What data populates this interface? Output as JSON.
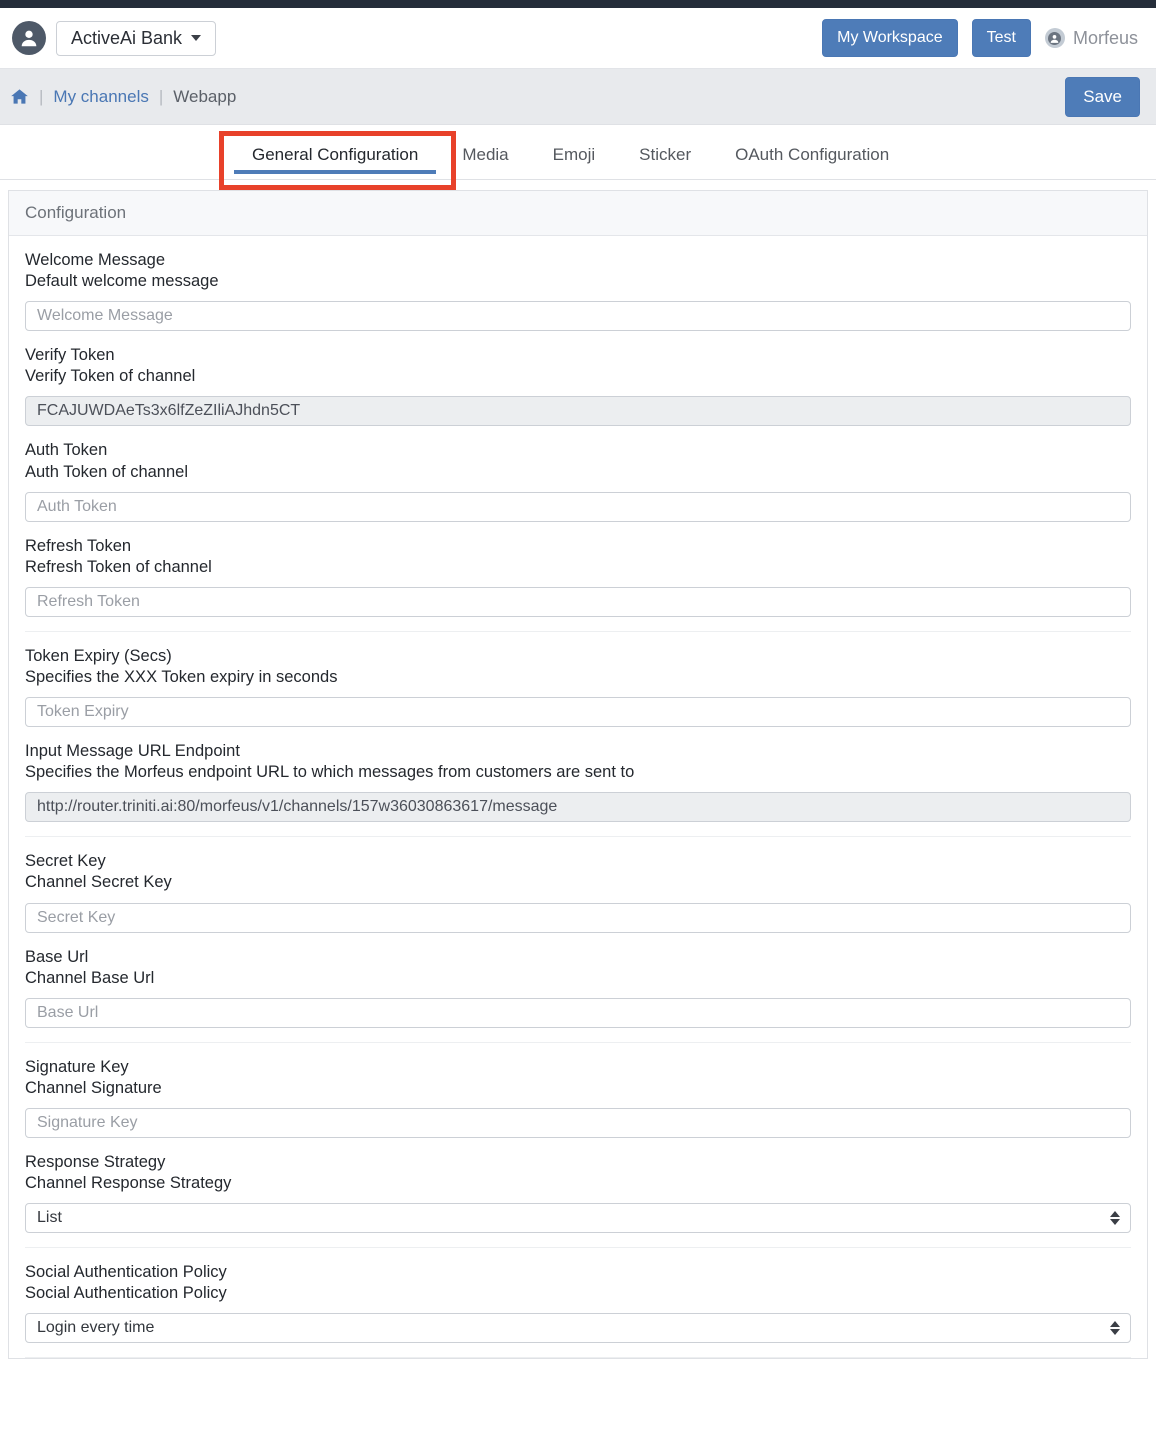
{
  "topbar": {
    "avatar_icon": "user-avatar-icon",
    "org_name": "ActiveAi Bank",
    "workspace_button": "My Workspace",
    "test_button": "Test",
    "user_name": "Morfeus",
    "user_icon": "user-circle-icon"
  },
  "breadcrumb": {
    "home_icon": "home-icon",
    "separator": "|",
    "channels_link": "My channels",
    "current": "Webapp",
    "save_button": "Save"
  },
  "tabs": [
    {
      "label": "General Configuration",
      "active": true
    },
    {
      "label": "Media",
      "active": false
    },
    {
      "label": "Emoji",
      "active": false
    },
    {
      "label": "Sticker",
      "active": false
    },
    {
      "label": "OAuth Configuration",
      "active": false
    }
  ],
  "panel": {
    "title": "Configuration"
  },
  "fields": [
    {
      "label": "Welcome Message",
      "desc": "Default welcome message",
      "type": "text",
      "value": "",
      "placeholder": "Welcome Message",
      "readonly": false
    },
    {
      "label": "Verify Token",
      "desc": "Verify Token of channel",
      "type": "text",
      "value": "FCAJUWDAeTs3x6lfZeZIliAJhdn5CT",
      "placeholder": "",
      "readonly": true
    },
    {
      "label": "Auth Token",
      "desc": "Auth Token of channel",
      "type": "text",
      "value": "",
      "placeholder": "Auth Token",
      "readonly": false
    },
    {
      "label": "Refresh Token",
      "desc": "Refresh Token of channel",
      "type": "text",
      "value": "",
      "placeholder": "Refresh Token",
      "readonly": false
    },
    {
      "label": "Token Expiry (Secs)",
      "desc": "Specifies the XXX Token expiry in seconds",
      "type": "text",
      "value": "",
      "placeholder": "Token Expiry",
      "readonly": false
    },
    {
      "label": "Input Message URL Endpoint",
      "desc": "Specifies the Morfeus endpoint URL to which messages from customers are sent to",
      "type": "text",
      "value": "http://router.triniti.ai:80/morfeus/v1/channels/157w36030863617/message",
      "placeholder": "",
      "readonly": true
    },
    {
      "label": "Secret Key",
      "desc": "Channel Secret Key",
      "type": "text",
      "value": "",
      "placeholder": "Secret Key",
      "readonly": false
    },
    {
      "label": "Base Url",
      "desc": "Channel Base Url",
      "type": "text",
      "value": "",
      "placeholder": "Base Url",
      "readonly": false
    },
    {
      "label": "Signature Key",
      "desc": "Channel Signature",
      "type": "text",
      "value": "",
      "placeholder": "Signature Key",
      "readonly": false
    },
    {
      "label": "Response Strategy",
      "desc": "Channel Response Strategy",
      "type": "select",
      "value": "List",
      "placeholder": "",
      "readonly": false
    },
    {
      "label": "Social Authentication Policy",
      "desc": "Social Authentication Policy",
      "type": "select",
      "value": "Login every time",
      "placeholder": "",
      "readonly": false
    }
  ],
  "colors": {
    "accent_blue": "#4e7cb8",
    "link_blue": "#4a77b4",
    "annotation_red": "#e8412a",
    "dark_strip": "#252d3a",
    "crumb_bg": "#e8eaed",
    "readonly_bg": "#eceef0"
  }
}
